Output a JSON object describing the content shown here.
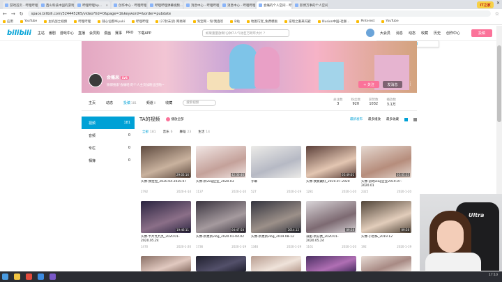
{
  "browser": {
    "tabs": [
      {
        "title": "游戏首页 - 哔哩哔哩",
        "active": false
      },
      {
        "title": "西山科技中国的游戏",
        "active": false
      },
      {
        "title": "哔哩哔哩Ap...",
        "active": false
      },
      {
        "title": "创作中心 - 哔哩哔哩",
        "active": false
      },
      {
        "title": "哔哩哔哩弹幕视频...",
        "active": false
      },
      {
        "title": "消息中心 - 哔哩哔哩",
        "active": false
      },
      {
        "title": "消息中心 - 哔哩哔哩",
        "active": false
      },
      {
        "title": "会痛的个人空间 - 哔",
        "active": true
      },
      {
        "title": "影博万事的个人空间",
        "active": false
      }
    ],
    "window_controls": [
      "−",
      "□",
      "✕"
    ],
    "url": "space.bilibili.com/324445265/video?tid=0&page=1&keyword=&order=pubdate",
    "nav": [
      "←",
      "→",
      "↻"
    ],
    "bookmarks": [
      "应用",
      "YouTube",
      "主机战士视频",
      "哔哩哔哩",
      "随心仙客Miyuki",
      "哔哩哔哩",
      "(27封未读) 网易邮",
      "淘宝网 - 淘!我喜欢",
      "B站",
      "地图巧宠_免费模板",
      "逆境之重来闪避",
      "Illusion中国-社群...",
      "Pinterest",
      "YouTube"
    ]
  },
  "header": {
    "logo": "bilibili",
    "nav": [
      "主站",
      "番剧",
      "游戏中心",
      "直播",
      "会员购",
      "漫画",
      "赛事",
      "PRO",
      "下载APP"
    ],
    "search_placeholder": "如果重量放啊!分钟7人气动巨万跨年大片 ?",
    "right": [
      "大会员",
      "消息",
      "动态",
      "收藏",
      "历史",
      "创作中心"
    ],
    "upload": "投稿",
    "tip_text": "你有5条充电消息",
    "tip_link": "查看详情"
  },
  "profile": {
    "name": "会痛呆",
    "badge": "LV6",
    "sign": "微博搜索'会痛哈'的个人主页加粉丝团啦~",
    "follow": "+ 关注",
    "message": "发消息",
    "more": "⋮"
  },
  "subnav": {
    "items": [
      {
        "label": "主页",
        "count": ""
      },
      {
        "label": "动态",
        "count": ""
      },
      {
        "label": "投稿",
        "count": "181"
      },
      {
        "label": "频道",
        "count": "0"
      },
      {
        "label": "收藏",
        "count": ""
      }
    ],
    "search_placeholder": "搜索视频",
    "stats": [
      {
        "label": "关注数",
        "value": "3"
      },
      {
        "label": "粉丝数",
        "value": "920"
      },
      {
        "label": "获赞数",
        "value": "1032"
      },
      {
        "label": "播放数",
        "value": "3.1万"
      }
    ]
  },
  "sidebar": [
    {
      "label": "视频",
      "count": "181",
      "active": true
    },
    {
      "label": "音频",
      "count": "0",
      "active": false
    },
    {
      "label": "专栏",
      "count": "0",
      "active": false
    },
    {
      "label": "相簿",
      "count": "0",
      "active": false
    }
  ],
  "main": {
    "title": "TA的视频",
    "play_all": "播放全部",
    "sorts": [
      "最新发布",
      "最多播放",
      "最多收藏"
    ],
    "filters": [
      {
        "label": "全部",
        "count": "181"
      },
      {
        "label": "音乐",
        "count": "6"
      },
      {
        "label": "舞蹈",
        "count": "23"
      },
      {
        "label": "生活",
        "count": "14"
      }
    ]
  },
  "videos": [
    {
      "title": "头像-我拉拉_2020.04-2020.07",
      "duration": "29:03:16",
      "plays": "2792",
      "date": "2020-4-14",
      "c1": "#5e4a3f",
      "c2": "#c9b29e"
    },
    {
      "title": "头像-新vlog企业_2020.03",
      "duration": "42:30:46",
      "plays": "1137",
      "date": "2020-2-10",
      "c1": "#f1e6e4",
      "c2": "#c4a19a"
    },
    {
      "title": "字幕",
      "duration": "",
      "plays": "527",
      "date": "2020-2-19",
      "c1": "#ecebe8",
      "c2": "#b6b9c4"
    },
    {
      "title": "头像-我要藏好_2019.07-2020",
      "duration": "05:49:01",
      "plays": "1281",
      "date": "2020-1-20",
      "c1": "#5b3f39",
      "c2": "#e3c6b2"
    },
    {
      "title": "头像-游戏vlog企业2019.07-2020.01",
      "duration": "05:05:35",
      "plays": "2325",
      "date": "2020-1-20",
      "c1": "#e5d8d0",
      "c2": "#b68d7c"
    },
    {
      "title": "头像-卡片九九九_2020.01-2020.05.24",
      "duration": "19:46:11",
      "plays": "1470",
      "date": "2020-1-20",
      "c1": "#2a2440",
      "c2": "#8b6f88"
    },
    {
      "title": "头像-新更新vlog_2020.01-04.02",
      "duration": "04:47:58",
      "plays": "1736",
      "date": "2020-1-19",
      "c1": "#3b3540",
      "c2": "#a59a9e"
    },
    {
      "title": "头像-新更新vlog_2019.08-12",
      "duration": "2014.12",
      "plays": "1346",
      "date": "2020-1-19",
      "c1": "#34353f",
      "c2": "#9c9089"
    },
    {
      "title": "减肥-新分类_2020.01-2020.05.24",
      "duration": "09:28",
      "plays": "1161",
      "date": "2020-1-20",
      "c1": "#d9d5d8",
      "c2": "#7d6a72"
    },
    {
      "title": "头像-小恐怖_2019.12",
      "duration": "09:28",
      "plays": "192",
      "date": "2020-1-19",
      "c1": "#514539",
      "c2": "#e2cdbb"
    },
    {
      "title": "",
      "duration": "",
      "plays": "",
      "date": "",
      "c1": "#8a7066",
      "c2": "#e1c9c0"
    },
    {
      "title": "",
      "duration": "",
      "plays": "",
      "date": "",
      "c1": "#20202e",
      "c2": "#53506a"
    },
    {
      "title": "",
      "duration": "",
      "plays": "",
      "date": "",
      "c1": "#b89d90",
      "c2": "#efe3da"
    },
    {
      "title": "",
      "duration": "",
      "plays": "",
      "date": "",
      "c1": "#4b2f63",
      "c2": "#b06fb4"
    },
    {
      "title": "",
      "duration": "",
      "plays": "",
      "date": "",
      "c1": "#e8dcd5",
      "c2": "#a88a84"
    }
  ],
  "taskbar_time": "17:10",
  "corner_badge": "IT之家",
  "webcam_chair_brand": "Ultra"
}
